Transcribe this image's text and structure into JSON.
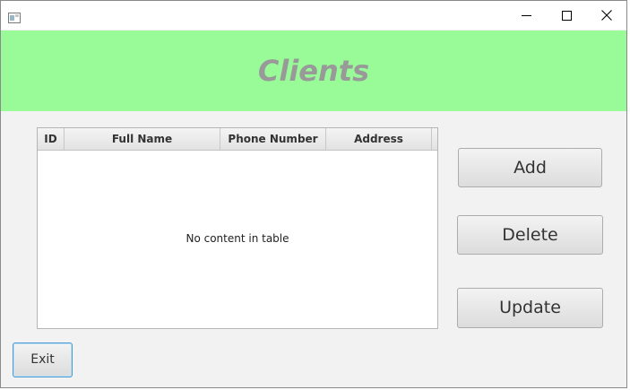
{
  "window": {
    "minimize_icon": "minimize-icon",
    "maximize_icon": "maximize-icon",
    "close_icon": "close-icon"
  },
  "header": {
    "title": "Clients",
    "background_color": "#98fb98",
    "title_color": "#999999"
  },
  "table": {
    "columns": [
      "ID",
      "Full Name",
      "Phone Number",
      "Address"
    ],
    "rows": [],
    "placeholder": "No content in table"
  },
  "buttons": {
    "add": "Add",
    "delete": "Delete",
    "update": "Update",
    "exit": "Exit"
  }
}
